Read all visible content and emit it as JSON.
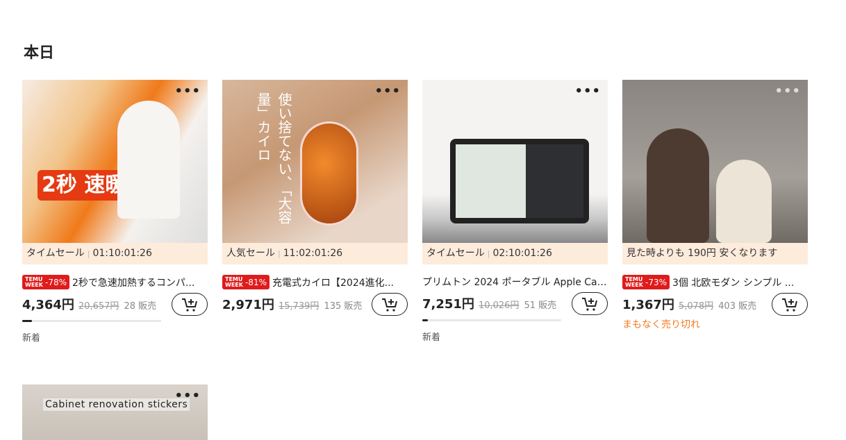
{
  "section_title": "本日",
  "more_label": "•••",
  "products": [
    {
      "banner_label": "タイムセール",
      "banner_time": "01:10:01:26",
      "badge_top": "TEMU",
      "badge_bottom": "WEEK",
      "discount": "-78%",
      "name": "2秒で急速加熱するコンパ...",
      "price": "4,364円",
      "original_price": "20,657円",
      "sold": "28 販売",
      "progress": 0.07,
      "tag": "新着",
      "image_text": "2秒 速暖"
    },
    {
      "banner_label": "人気セール",
      "banner_time": "11:02:01:26",
      "badge_top": "TEMU",
      "badge_bottom": "WEEK",
      "discount": "-81%",
      "name": "充電式カイロ【2024進化...",
      "price": "2,971円",
      "original_price": "15,739円",
      "sold": "135 販売",
      "image_text": "使い捨てない、「大容量」カイロ"
    },
    {
      "banner_label": "タイムセール",
      "banner_time": "02:10:01:26",
      "name": "プリムトン 2024 ポータブル Apple Car...",
      "price": "7,251円",
      "original_price": "10,026円",
      "sold": "51 販売",
      "progress": 0.04,
      "tag": "新着"
    },
    {
      "banner_label": "見た時よりも 190円 安くなります",
      "badge_top": "TEMU",
      "badge_bottom": "WEEK",
      "discount": "-73%",
      "name": "3個 北欧モダン シンプル ...",
      "price": "1,367円",
      "original_price": "5,078円",
      "sold": "403 販売",
      "status": "まもなく売り切れ"
    },
    {
      "image_text": "Cabinet renovation stickers"
    }
  ],
  "colors": {
    "accent": "#e01b1b",
    "banner_bg": "#fdebdc",
    "warning": "#f47b20"
  }
}
